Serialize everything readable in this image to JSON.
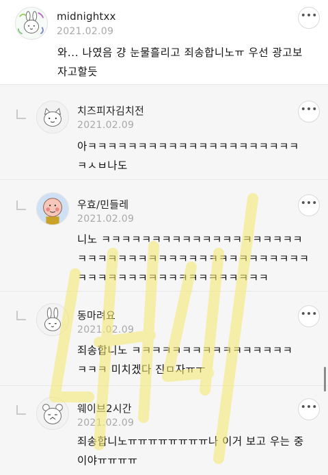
{
  "comments": [
    {
      "name": "midnightxx",
      "date": "2021.02.09",
      "text": "와... 나였음 걍 눈물흘리고 죄송합니노ㅠ 우선 광고보\n자고할듯",
      "more_icon": "more-options-icon"
    },
    {
      "name": "치즈피자김치전",
      "date": "2021.02.09",
      "text": "아ㅋㅋㅋㅋㅋㅋㅋㅋㅋㅋㅋㅋㅋㅋㅋㅋㅋㅋㅋㅋㅋ\nㅋㅅㅂ나도",
      "more_icon": "more-options-icon"
    },
    {
      "name": "우효/민들레",
      "date": "2021.02.09",
      "text": "니노 ㅋㅋㅋㅋㅋㅋㅋㅋㅋㅋㅋㅋㅋㅋㅋㅋㅋㅋㅋㅋ\nㅋㅋㅋㅋㅋㅋㅋㅋㅋㅋㅋㅋㅋㅋㅋㅋㅋㅋㅋㅋㅋㅋㅋ\nㅋㅋㅋㅋㅋㅋㅋㅋㅋㅋㅋㅋㅋㅋㅋㅋㅋㅋㅋ",
      "more_icon": "more-options-icon"
    },
    {
      "name": "동마려요",
      "date": "2021.02.09",
      "text": "죄송합니노 ㅋㅋㅋㅋㅋㅋㅋㅋㅋㅋㅋㅋㅋㅋㅋㅋ\nㅋㅋㅋ 미치겠다 진ㅁ자ㅠㅜ",
      "more_icon": "more-options-icon"
    },
    {
      "name": "웨이브2시간",
      "date": "2021.02.09",
      "text": "죄송합니노ㅠㅠㅠㅠㅠㅠㅠㅠ나 이거 보고 우는 중\n이야ㅠㅠㅠㅠ",
      "more_icon": "more-options-icon"
    }
  ],
  "colors": {
    "reply_bg": "#f6f6f6",
    "date": "#a8a8a8",
    "watermark": "#f5e96a"
  }
}
